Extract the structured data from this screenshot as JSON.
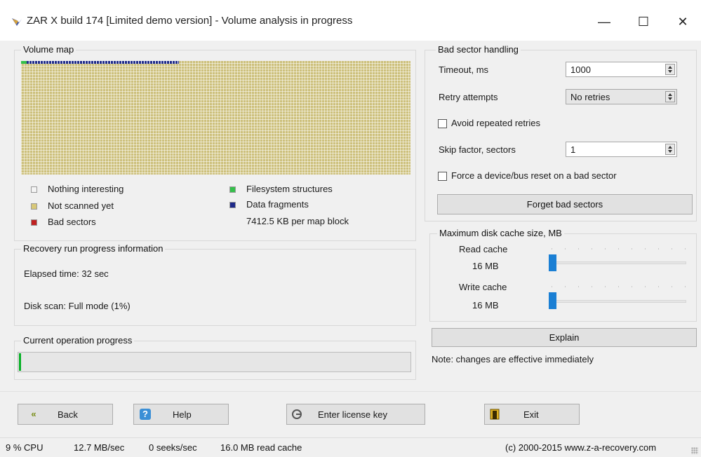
{
  "window": {
    "title": "ZAR X build 174 [Limited demo version] - Volume analysis in progress",
    "minimize_glyph": "—",
    "maximize_glyph": "☐",
    "close_glyph": "✕",
    "icon": "zar-app-icon"
  },
  "volume_map": {
    "label": "Volume map",
    "scanned_fraction": 0.01,
    "legend": [
      {
        "label": "Nothing interesting",
        "color": "#f4f4f4"
      },
      {
        "label": "Not scanned yet",
        "color": "#d8c878"
      },
      {
        "label": "Bad sectors",
        "color": "#c02020"
      },
      {
        "label": "Filesystem structures",
        "color": "#34c04a"
      },
      {
        "label": "Data fragments",
        "color": "#1e2a8a"
      }
    ],
    "block_size_text": "7412.5 KB per map block"
  },
  "recovery_info": {
    "label": "Recovery run progress information",
    "elapsed": "Elapsed time: 32 sec",
    "disk_scan": "Disk scan: Full mode (1%)"
  },
  "current_operation": {
    "label": "Current operation progress",
    "progress": 0.005
  },
  "bad_sector": {
    "label": "Bad sector handling",
    "timeout_label": "Timeout, ms",
    "timeout_value": "1000",
    "retry_label": "Retry attempts",
    "retry_value": "No retries",
    "avoid_label": "Avoid repeated retries",
    "avoid_checked": false,
    "skip_label": "Skip factor, sectors",
    "skip_value": "1",
    "reset_label": "Force a device/bus reset on a bad sector",
    "reset_checked": false,
    "forget_button": "Forget bad sectors"
  },
  "cache": {
    "label": "Maximum disk cache size, MB",
    "read_label": "Read cache",
    "read_value": "16 MB",
    "write_label": "Write cache",
    "write_value": "16 MB",
    "read_level": 0.0,
    "write_level": 0.0,
    "explain_button": "Explain",
    "note": "Note: changes are effective immediately"
  },
  "nav": {
    "back": "Back",
    "help": "Help",
    "license": "Enter license key",
    "exit": "Exit",
    "back_icon": "double-left-arrow-icon",
    "help_icon": "help-icon",
    "license_icon": "key-icon",
    "exit_icon": "door-icon"
  },
  "status": {
    "cpu": "9 % CPU",
    "throughput": "12.7 MB/sec",
    "seeks": "0 seeks/sec",
    "cache": "16.0 MB read cache",
    "copyright": "(c) 2000-2015 www.z-a-recovery.com"
  }
}
